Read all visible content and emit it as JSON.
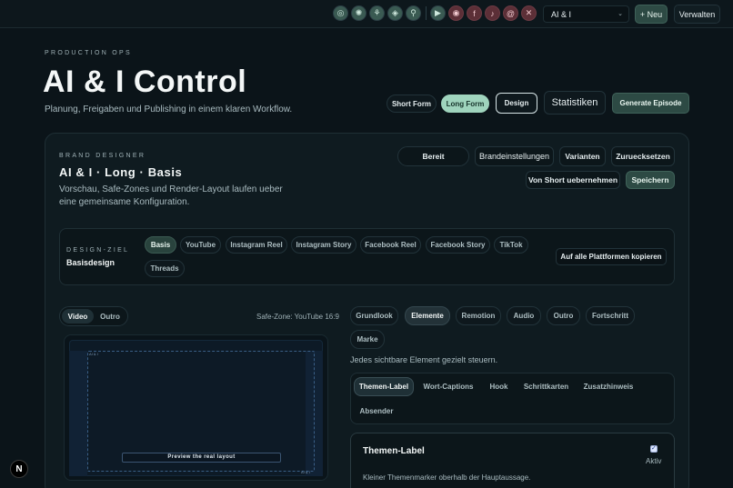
{
  "topbar": {
    "status_icons": [
      {
        "icon": "database-icon",
        "glyph": "◎",
        "tone": "green"
      },
      {
        "icon": "sun-icon",
        "glyph": "✺",
        "tone": "green"
      },
      {
        "icon": "plant-icon",
        "glyph": "⚘",
        "tone": "green"
      },
      {
        "icon": "broadcast-icon",
        "glyph": "◈",
        "tone": "green"
      },
      {
        "icon": "microphone-icon",
        "glyph": "⚲",
        "tone": "green"
      }
    ],
    "platform_icons": [
      {
        "icon": "youtube-icon",
        "glyph": "▶",
        "tone": "green"
      },
      {
        "icon": "instagram-icon",
        "glyph": "◉",
        "tone": "red"
      },
      {
        "icon": "facebook-icon",
        "glyph": "f",
        "tone": "red"
      },
      {
        "icon": "tiktok-icon",
        "glyph": "♪",
        "tone": "red"
      },
      {
        "icon": "threads-icon",
        "glyph": "@",
        "tone": "red"
      },
      {
        "icon": "x-icon",
        "glyph": "✕",
        "tone": "red"
      }
    ],
    "project_select": "AI & I",
    "new_label": "+ Neu",
    "manage_label": "Verwalten"
  },
  "hero": {
    "eyebrow": "PRODUCTION OPS",
    "title": "AI & I Control",
    "subtitle": "Planung, Freigaben und Publishing in einem klaren Workflow."
  },
  "modes": {
    "short_form": "Short Form",
    "long_form": "Long Form",
    "design": "Design",
    "statistiken": "Statistiken",
    "generate": "Generate Episode"
  },
  "designer": {
    "eyebrow": "BRAND DESIGNER",
    "title": "AI & I · Long · Basis",
    "subtitle": "Vorschau, Safe-Zones und Render-Layout laufen ueber eine gemeinsame Konfiguration.",
    "actions": {
      "ready": "Bereit",
      "brand_settings": "Brandeinstellungen",
      "variants": "Varianten",
      "reset": "Zuruecksetzen",
      "from_short": "Von Short uebernehmen",
      "save": "Speichern"
    }
  },
  "target": {
    "eyebrow": "DESIGN-ZIEL",
    "value": "Basisdesign",
    "chips": [
      "Basis",
      "YouTube",
      "Instagram Reel",
      "Instagram Story",
      "Facebook Reel",
      "Facebook Story",
      "TikTok",
      "Threads"
    ],
    "copy_all": "Auf alle Plattformen kopieren"
  },
  "preview": {
    "toggle": [
      "Video",
      "Outro"
    ],
    "safe_zone_label": "Safe-Zone: YouTube 16:9",
    "caption_text": "Preview the real layout",
    "corner_tag": "AI & I",
    "corner_tag_br": "AI & I"
  },
  "elements": {
    "tabs": [
      "Grundlook",
      "Elemente",
      "Remotion",
      "Audio",
      "Outro",
      "Fortschritt",
      "Marke"
    ],
    "description": "Jedes sichtbare Element gezielt steuern.",
    "subtabs": [
      "Themen-Label",
      "Wort-Captions",
      "Hook",
      "Schrittkarten",
      "Zusatzhinweis",
      "Absender"
    ],
    "card": {
      "title": "Themen-Label",
      "description": "Kleiner Themenmarker oberhalb der Hauptaussage.",
      "active_label": "Aktiv"
    }
  },
  "badge": "N"
}
